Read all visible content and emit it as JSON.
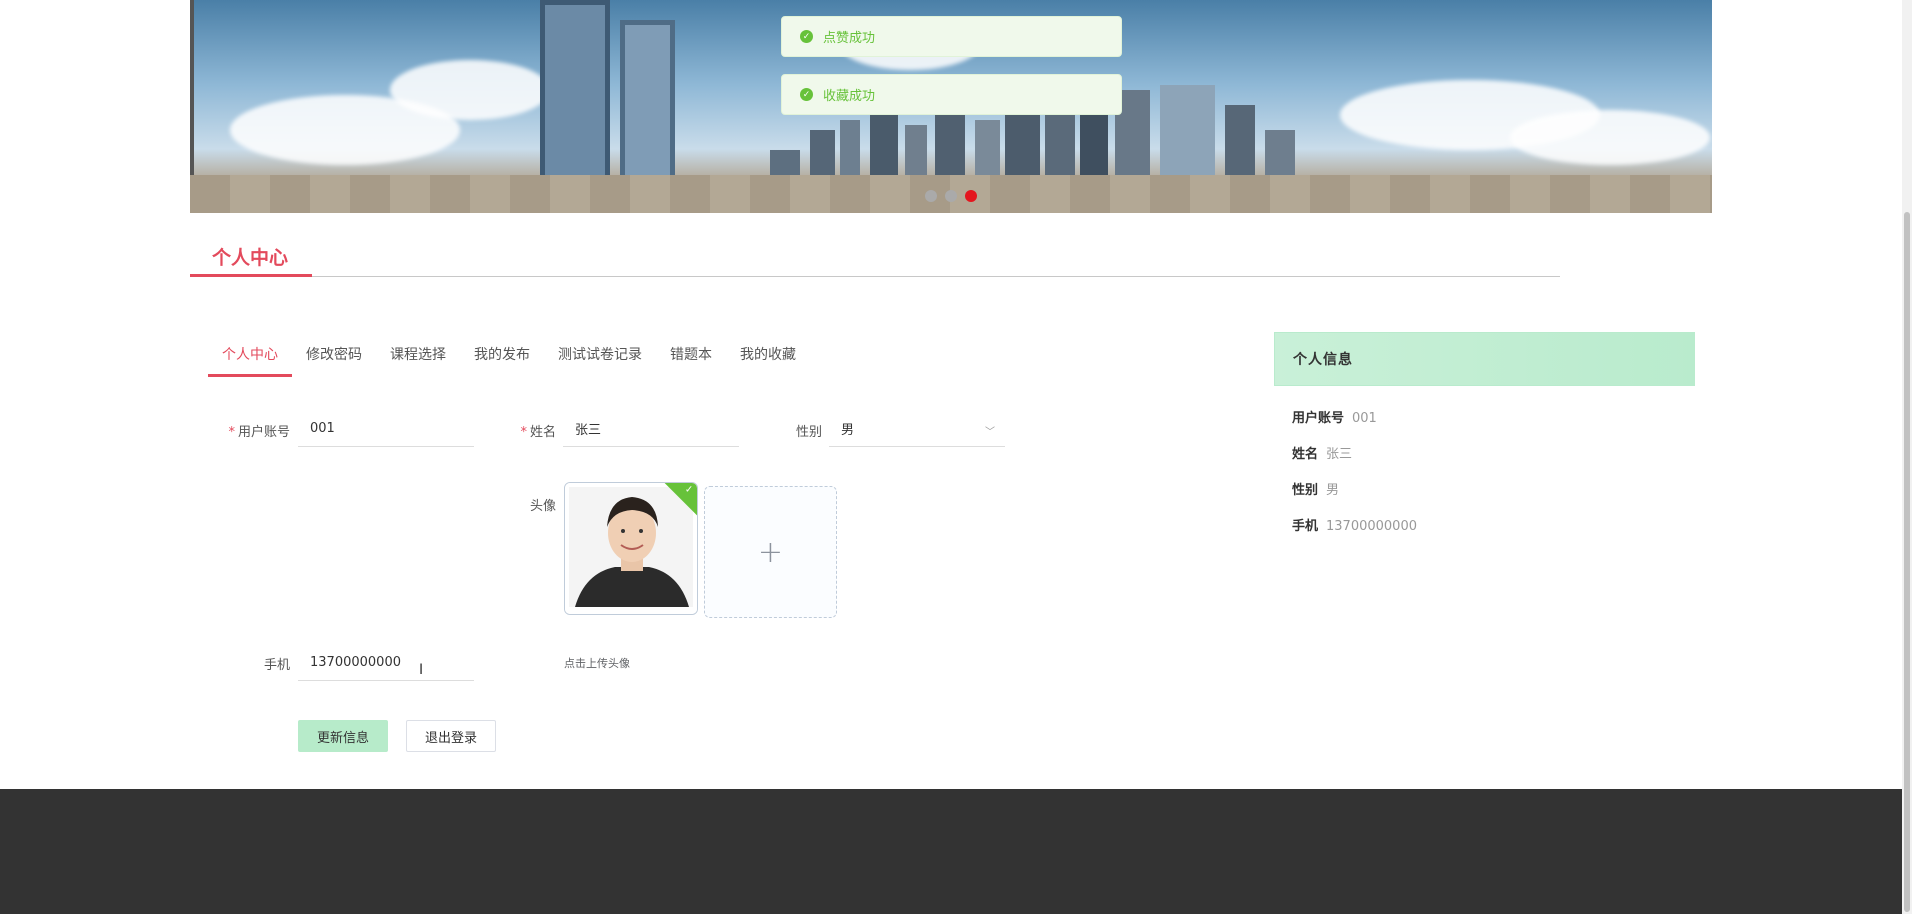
{
  "toasts": [
    {
      "text": "点赞成功"
    },
    {
      "text": "收藏成功"
    }
  ],
  "carousel": {
    "count": 3,
    "active_index": 2
  },
  "section": {
    "title": "个人中心"
  },
  "tabs": [
    {
      "label": "个人中心",
      "active": true
    },
    {
      "label": "修改密码",
      "active": false
    },
    {
      "label": "课程选择",
      "active": false
    },
    {
      "label": "我的发布",
      "active": false
    },
    {
      "label": "测试试卷记录",
      "active": false
    },
    {
      "label": "错题本",
      "active": false
    },
    {
      "label": "我的收藏",
      "active": false
    }
  ],
  "form": {
    "account_label": "用户账号",
    "account_value": "001",
    "name_label": "姓名",
    "name_value": "张三",
    "gender_label": "性别",
    "gender_value": "男",
    "avatar_label": "头像",
    "upload_hint": "点击上传头像",
    "phone_label": "手机",
    "phone_value": "13700000000",
    "update_button": "更新信息",
    "logout_button": "退出登录"
  },
  "info_panel": {
    "title": "个人信息",
    "rows": [
      {
        "key": "用户账号",
        "value": "001"
      },
      {
        "key": "姓名",
        "value": "张三"
      },
      {
        "key": "性别",
        "value": "男"
      },
      {
        "key": "手机",
        "value": "13700000000"
      }
    ]
  },
  "colors": {
    "accent": "#e34a5c",
    "success": "#67c23a",
    "primary_button": "#b7ebca",
    "footer": "#333333"
  }
}
